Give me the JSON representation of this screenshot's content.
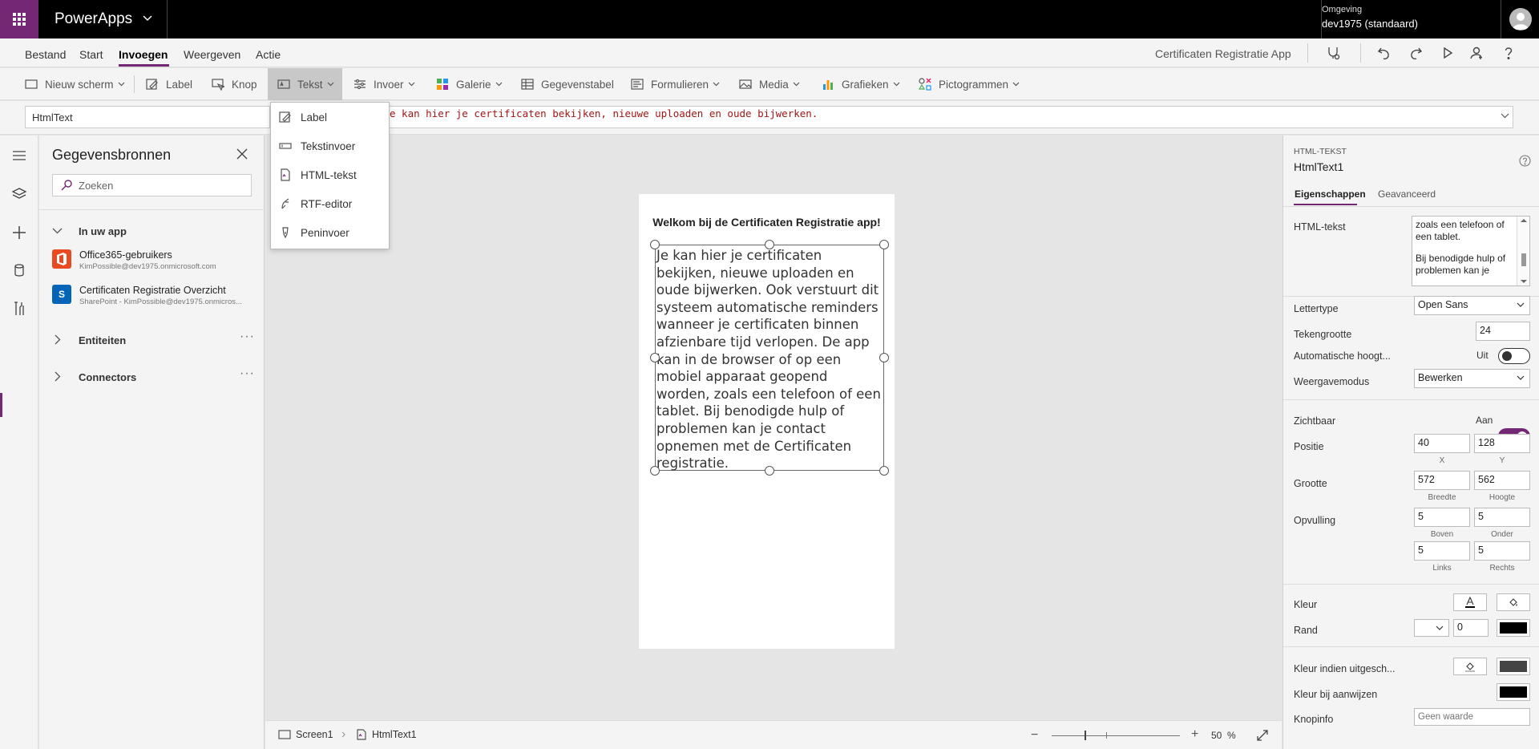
{
  "topbar": {
    "app_name": "PowerApps",
    "env_label": "Omgeving",
    "env_value": "dev1975 (standaard)"
  },
  "menubar": {
    "items": [
      "Bestand",
      "Start",
      "Invoegen",
      "Weergeven",
      "Actie"
    ],
    "active": "Invoegen",
    "app_title": "Certificaten Registratie App"
  },
  "ribbon": {
    "items": [
      "Nieuw scherm",
      "Label",
      "Knop",
      "Tekst",
      "Invoer",
      "Galerie",
      "Gegevenstabel",
      "Formulieren",
      "Media",
      "Grafieken",
      "Pictogrammen"
    ]
  },
  "formula": {
    "property": "HtmlText",
    "expression": "e kan hier je certificaten bekijken, nieuwe uploaden en oude bijwerken."
  },
  "dropdown": {
    "items": [
      "Label",
      "Tekstinvoer",
      "HTML-tekst",
      "RTF-editor",
      "Peninvoer"
    ]
  },
  "datasources": {
    "title": "Gegevensbronnen",
    "search_placeholder": "Zoeken",
    "group_in_app": "In uw app",
    "sources": [
      {
        "name": "Office365-gebruikers",
        "sub": "KimPossible@dev1975.onmicrosoft.com"
      },
      {
        "name": "Certificaten Registratie Overzicht",
        "sub": "SharePoint - KimPossible@dev1975.onmicros..."
      }
    ],
    "group_entities": "Entiteiten",
    "group_connectors": "Connectors"
  },
  "canvas": {
    "welcome": "Welkom bij de Certificaten Registratie app!",
    "html_text": "Je kan hier je certificaten bekijken, nieuwe uploaden en oude bijwerken. Ook verstuurt dit systeem automatische reminders wanneer je certificaten binnen afzienbare tijd verlopen. De app kan in de browser of op een mobiel apparaat geopend worden, zoals een telefoon of een tablet. Bij benodigde hulp of problemen kan je contact opnemen met de Certificaten registratie."
  },
  "statusbar": {
    "screen": "Screen1",
    "control": "HtmlText1",
    "zoom": "50",
    "zoom_unit": "%"
  },
  "props": {
    "type": "HTML-TEKST",
    "name": "HtmlText1",
    "tab_properties": "Eigenschappen",
    "tab_advanced": "Geavanceerd",
    "html_label": "HTML-tekst",
    "html_value_1": "zoals een telefoon of een tablet.",
    "html_value_2": "Bij benodigde hulp of problemen kan je",
    "font_label": "Lettertype",
    "font_value": "Open Sans",
    "size_label": "Tekengrootte",
    "size_value": "24",
    "autoheight_label": "Automatische hoogt...",
    "autoheight_value": "Uit",
    "mode_label": "Weergavemodus",
    "mode_value": "Bewerken",
    "visible_label": "Zichtbaar",
    "visible_value": "Aan",
    "position_label": "Positie",
    "pos_x": "40",
    "pos_y": "128",
    "x_label": "X",
    "y_label": "Y",
    "size2_label": "Grootte",
    "width_value": "572",
    "height_value": "562",
    "width_label": "Breedte",
    "height_label": "Hoogte",
    "padding_label": "Opvulling",
    "pad_top": "5",
    "pad_bottom": "5",
    "pad_left": "5",
    "pad_right": "5",
    "top_label": "Boven",
    "bottom_label": "Onder",
    "left_label": "Links",
    "right_label": "Rechts",
    "color_label": "Kleur",
    "border_label": "Rand",
    "border_value": "0",
    "disabled_color_label": "Kleur indien uitgesch...",
    "hover_color_label": "Kleur bij aanwijzen",
    "tooltip_label": "Knopinfo",
    "tooltip_placeholder": "Geen waarde"
  },
  "colors": {
    "accent": "#742774",
    "topbar": "#000000",
    "formula_text": "#a31515"
  }
}
